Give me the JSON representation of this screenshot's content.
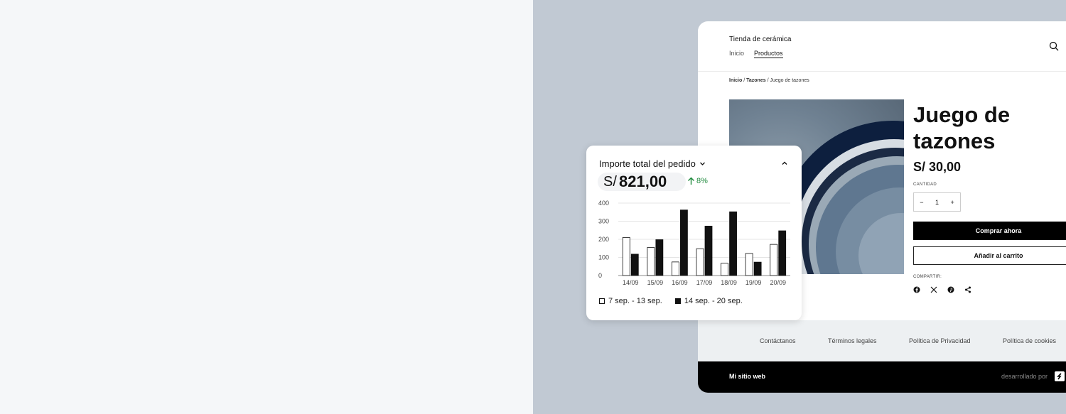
{
  "website": {
    "store_name": "Tienda de cerámica",
    "nav": [
      {
        "label": "Inicio",
        "active": false
      },
      {
        "label": "Productos",
        "active": true
      }
    ],
    "breadcrumb": {
      "home": "Inicio",
      "sep1": " / ",
      "category": "Tazones",
      "sep2": " / ",
      "current": "Juego de tazones"
    },
    "product": {
      "title": "Juego de tazones",
      "price": "S/ 30,00",
      "quantity_label": "CANTIDAD",
      "quantity": "1",
      "minus": "−",
      "plus": "+",
      "buy_now": "Comprar ahora",
      "add_to_cart": "Añadir al carrito",
      "share_label": "COMPARTIR:",
      "share_icons": [
        "facebook-icon",
        "x-icon",
        "pinterest-icon",
        "share-icon"
      ]
    },
    "footer_links": [
      "Contáctanos",
      "Términos legales",
      "Política de Privacidad",
      "Política de cookies"
    ],
    "footer_site": "Mi sitio web",
    "footer_dev": "desarrollado por"
  },
  "card": {
    "title": "Importe total del pedido",
    "currency": "S/",
    "total": "821,00",
    "change": "8%",
    "change_color": "#1f8a3d"
  },
  "chart_data": {
    "type": "bar",
    "categories": [
      "14/09",
      "15/09",
      "16/09",
      "17/09",
      "18/09",
      "19/09",
      "20/09"
    ],
    "series": [
      {
        "name": "7 sep. - 13 sep.",
        "values": [
          210,
          155,
          75,
          148,
          68,
          122,
          172
        ],
        "color": "#ffffff"
      },
      {
        "name": "14 sep. - 20 sep.",
        "values": [
          118,
          198,
          362,
          273,
          352,
          74,
          247
        ],
        "color": "#111111"
      }
    ],
    "yticks": [
      0,
      100,
      200,
      300,
      400
    ],
    "ylim": [
      0,
      400
    ],
    "grid": true,
    "legend": "bottom-left"
  }
}
